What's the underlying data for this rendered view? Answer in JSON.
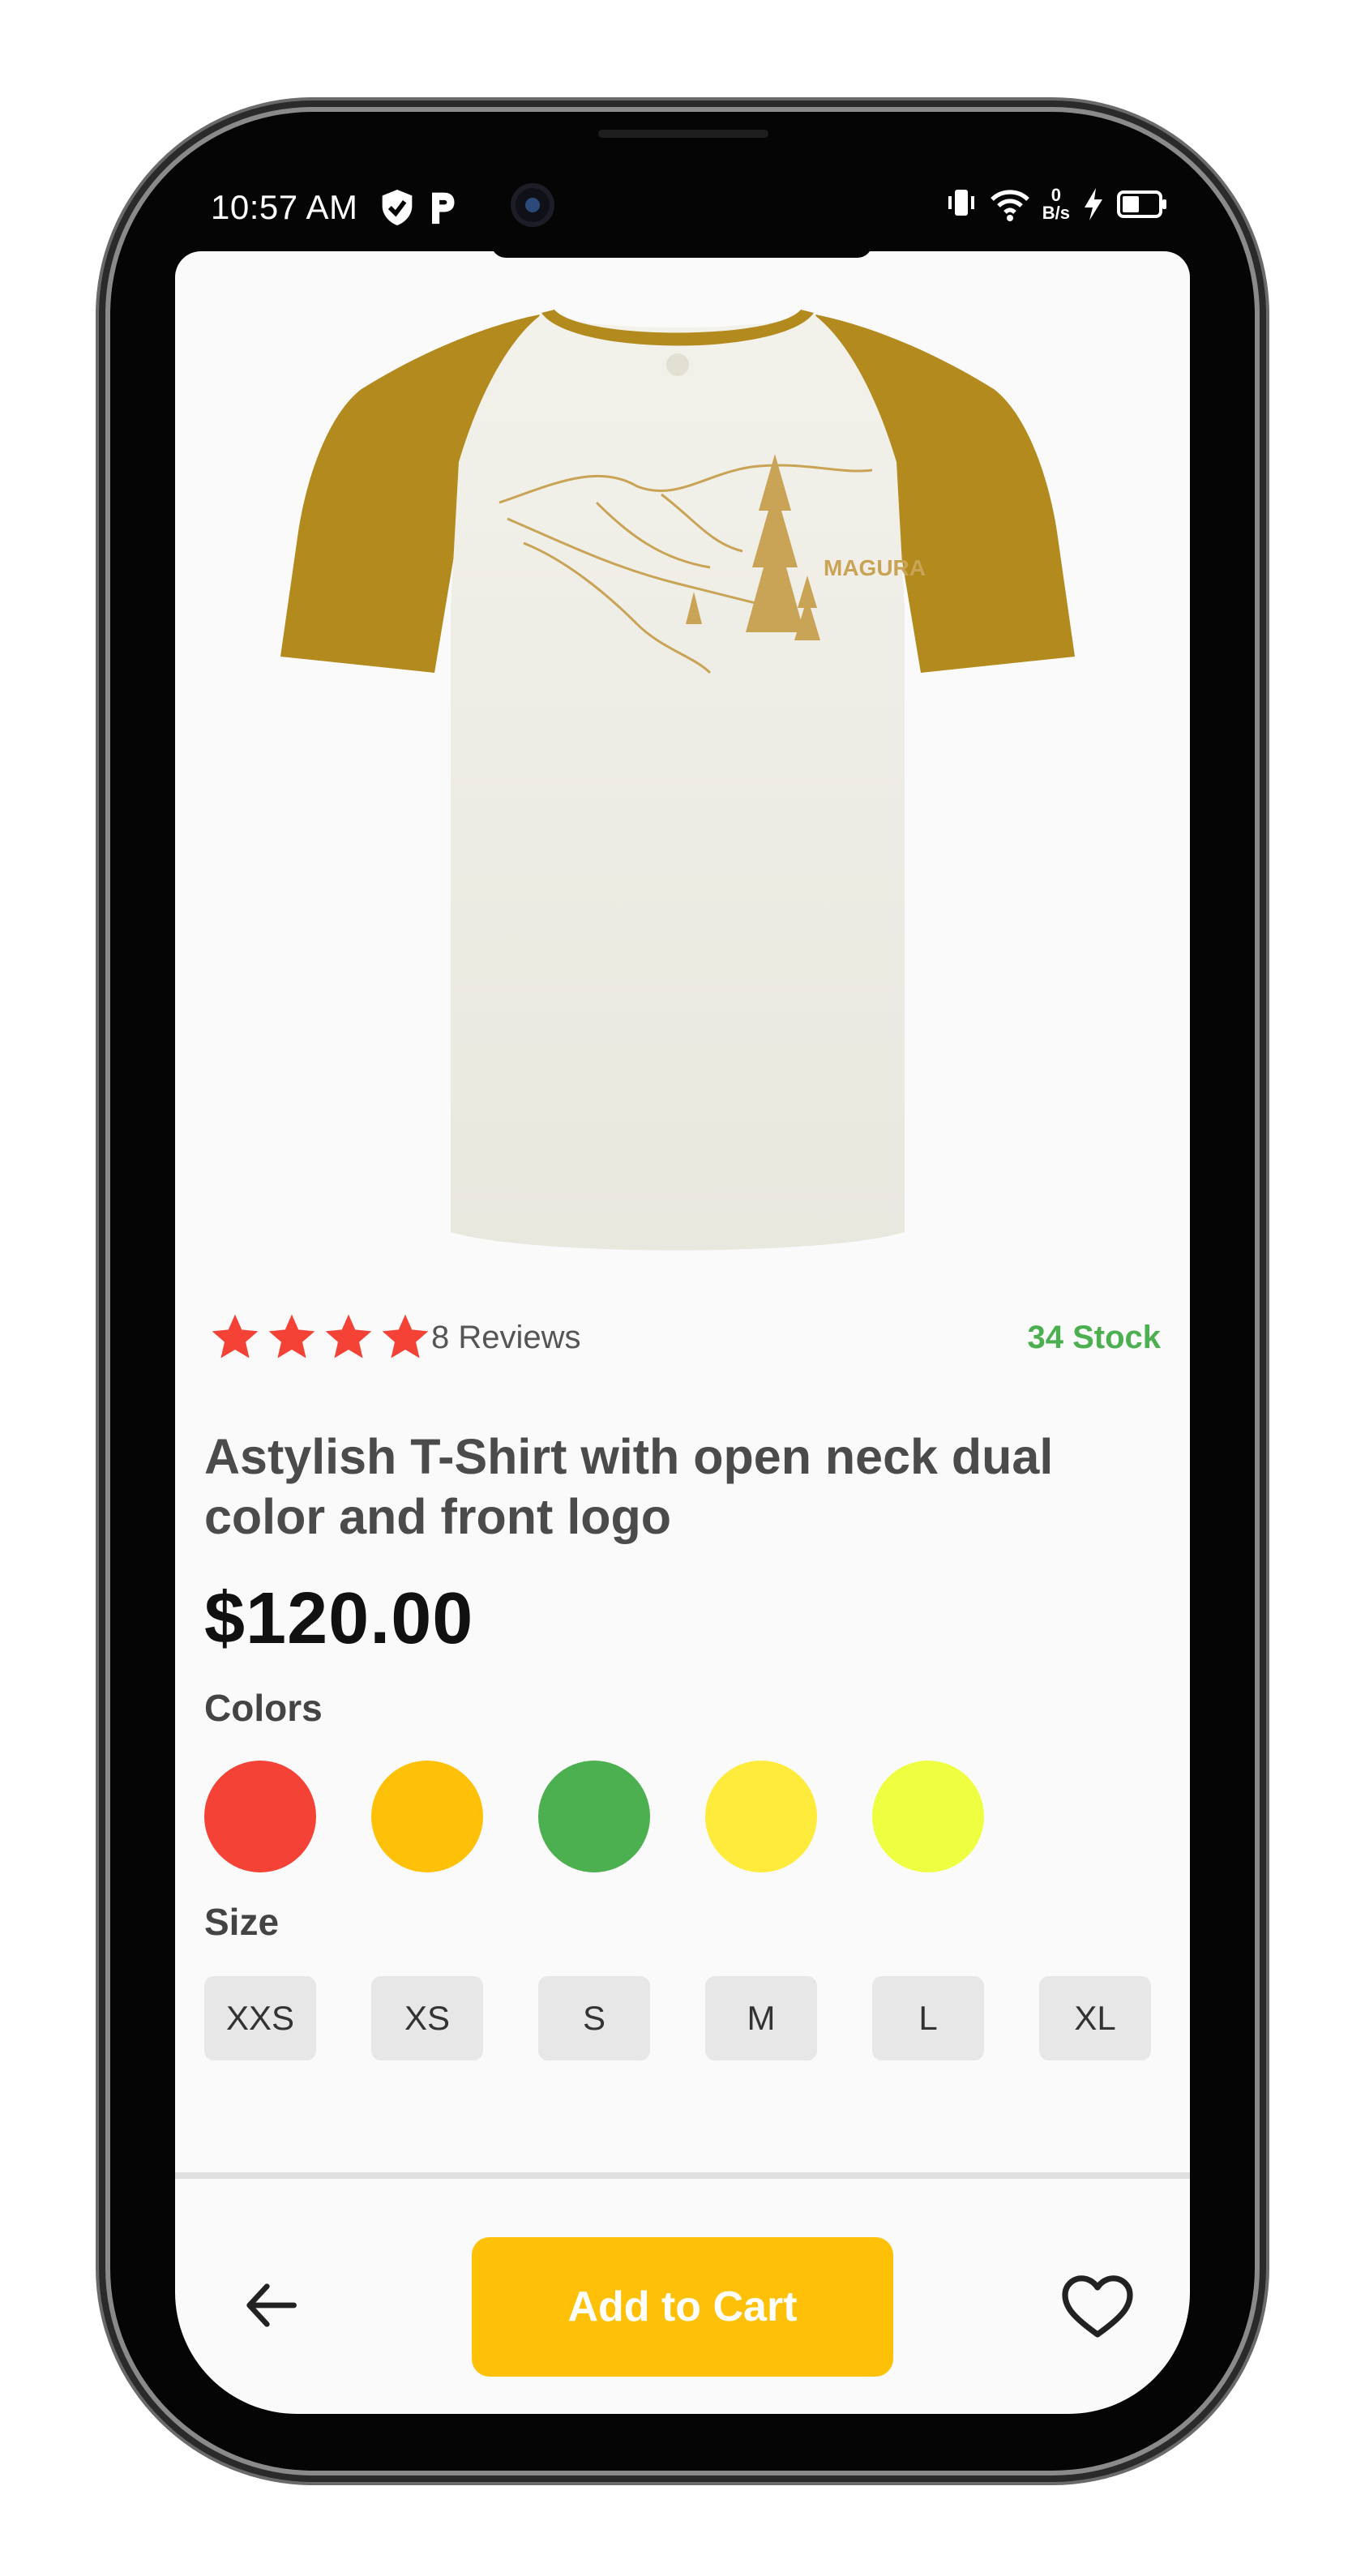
{
  "status_bar": {
    "time": "10:57 AM",
    "left_icons": [
      "shield-check-icon",
      "p-icon"
    ],
    "right_icons": [
      "vibrate-icon",
      "wifi-icon",
      "data-speed",
      "charging-icon",
      "battery-icon"
    ],
    "data_speed_value": "0",
    "data_speed_unit": "B/s"
  },
  "product": {
    "image": {
      "description_icon": "tshirt-image",
      "print_text": "MAGURA"
    },
    "rating": {
      "stars": 4,
      "max_stars": 4
    },
    "reviews_label": "8 Reviews",
    "stock_label": "34 Stock",
    "title": "Astylish T-Shirt with open neck dual color and front logo",
    "price": "$120.00"
  },
  "colors": {
    "label": "Colors",
    "options": [
      {
        "name": "red",
        "hex": "#f44336"
      },
      {
        "name": "amber",
        "hex": "#ffc107"
      },
      {
        "name": "green",
        "hex": "#4caf50"
      },
      {
        "name": "yellow",
        "hex": "#ffeb3b"
      },
      {
        "name": "lime",
        "hex": "#eeff41"
      }
    ]
  },
  "sizes": {
    "label": "Size",
    "options": [
      "XXS",
      "XS",
      "S",
      "M",
      "L",
      "XL"
    ]
  },
  "bottom_bar": {
    "back_icon": "arrow-left-icon",
    "add_to_cart_label": "Add to Cart",
    "favorite_icon": "heart-outline-icon"
  },
  "theme": {
    "accent": "#ffc107",
    "stock_color": "#4caf50",
    "star_color": "#f44336"
  }
}
